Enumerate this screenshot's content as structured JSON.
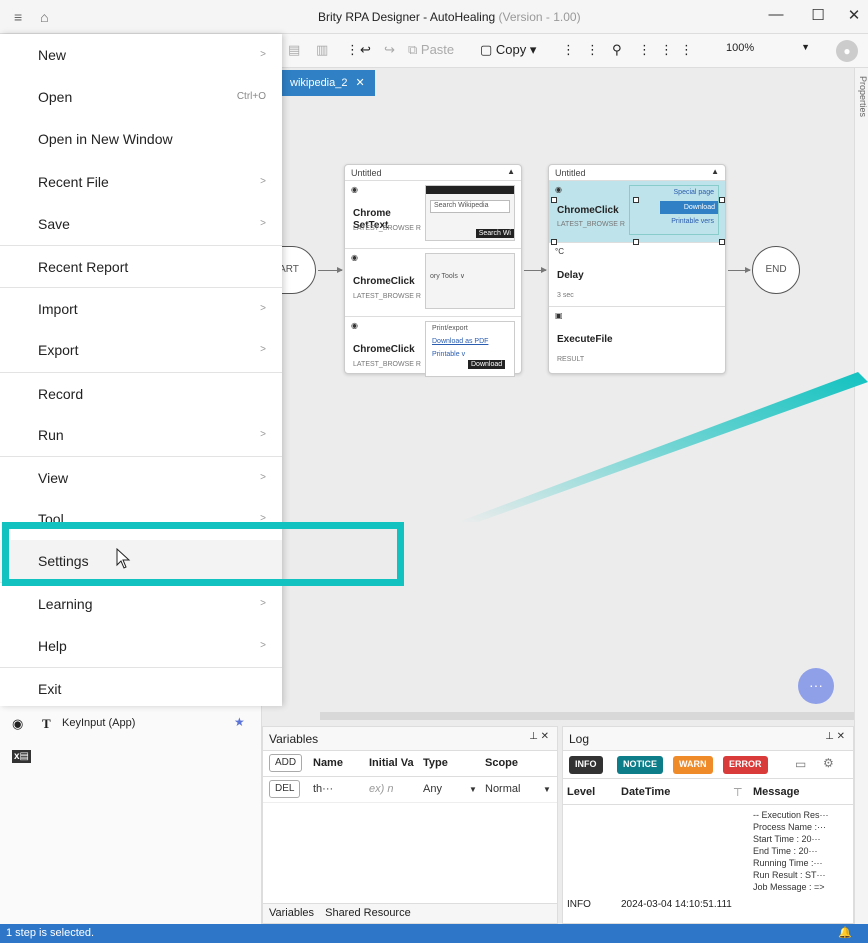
{
  "window": {
    "title": "Brity RPA Designer - AutoHealing",
    "version": "(Version - 1.00)",
    "menu_icon": "hamburger-icon",
    "home_icon": "home-icon",
    "minimize": "—",
    "maximize": "☐",
    "close": "✕"
  },
  "toolbar": {
    "paste_label": "Paste",
    "copy_label": "Copy",
    "zoom_value": "100%"
  },
  "tab": {
    "label": "wikipedia_2",
    "close": "✕"
  },
  "right_panel_label": "Properties",
  "menu": {
    "items": [
      {
        "label": "New",
        "shortcut": "",
        "chevron": ">",
        "sep": false
      },
      {
        "label": "Open",
        "shortcut": "Ctrl+O",
        "chevron": "",
        "sep": false
      },
      {
        "label": "Open in New Window",
        "shortcut": "",
        "chevron": "",
        "sep": false
      },
      {
        "label": "Recent File",
        "shortcut": "",
        "chevron": ">",
        "sep": false
      },
      {
        "label": "Save",
        "shortcut": "",
        "chevron": ">",
        "sep": false
      },
      {
        "label": "Recent Report",
        "shortcut": "",
        "chevron": "",
        "sep": true
      },
      {
        "label": "Import",
        "shortcut": "",
        "chevron": ">",
        "sep": true
      },
      {
        "label": "Export",
        "shortcut": "",
        "chevron": ">",
        "sep": false
      },
      {
        "label": "Record",
        "shortcut": "",
        "chevron": "",
        "sep": true
      },
      {
        "label": "Run",
        "shortcut": "",
        "chevron": ">",
        "sep": false
      },
      {
        "label": "View",
        "shortcut": "",
        "chevron": ">",
        "sep": true
      },
      {
        "label": "Tool",
        "shortcut": "",
        "chevron": ">",
        "sep": false
      },
      {
        "label": "Settings",
        "shortcut": "",
        "chevron": "",
        "sep": false
      },
      {
        "label": "Learning",
        "shortcut": "",
        "chevron": ">",
        "sep": true
      },
      {
        "label": "Help",
        "shortcut": "",
        "chevron": ">",
        "sep": false
      },
      {
        "label": "Exit",
        "shortcut": "",
        "chevron": "",
        "sep": true
      }
    ]
  },
  "flow": {
    "start_label": "START",
    "end_label": "END",
    "group1": {
      "title": "Untitled",
      "steps": [
        {
          "name": "Chrome SetText",
          "sub": "LATEST_BROWSE R",
          "thumb": "Search Wikipedia",
          "thumb2": "Search Wi"
        },
        {
          "name": "ChromeClick",
          "sub": "LATEST_BROWSE R",
          "thumb": "ory  Tools ∨",
          "thumb2": ""
        },
        {
          "name": "ChromeClick",
          "sub": "LATEST_BROWSE R",
          "thumb": "Print/export",
          "thumb2": "Download as PDF",
          "thumb3": "Printable v",
          "thumb4": "Download"
        }
      ]
    },
    "group2": {
      "title": "Untitled",
      "steps": [
        {
          "name": "ChromeClick",
          "sub": "LATEST_BROWSE R",
          "thumb": "Special page",
          "thumb2": "Download",
          "thumb3": "Printable vers"
        },
        {
          "name": "Delay",
          "sub": "3 sec",
          "icon": "°C"
        },
        {
          "name": "ExecuteFile",
          "sub": "RESULT",
          "icon": "▣"
        }
      ]
    }
  },
  "left_panel": {
    "item_label": "KeyInput (App)",
    "item_prefix": "T"
  },
  "variables": {
    "title": "Variables",
    "add_label": "ADD",
    "del_label": "DEL",
    "columns": [
      "Name",
      "Initial Va",
      "Type",
      "Scope"
    ],
    "row": {
      "name": "th···",
      "initial": "ex) n",
      "type": "Any",
      "scope": "Normal"
    },
    "tabs": [
      "Variables",
      "Shared Resource"
    ]
  },
  "log": {
    "title": "Log",
    "filters": [
      {
        "label": "INFO",
        "color": "#333333"
      },
      {
        "label": "NOTICE",
        "color": "#0d7d8a"
      },
      {
        "label": "WARN",
        "color": "#f08b2a"
      },
      {
        "label": "ERROR",
        "color": "#d93a3a"
      }
    ],
    "columns": [
      "Level",
      "DateTime",
      "Message"
    ],
    "row": {
      "level": "INFO",
      "datetime": "2024-03-04 14:10:51.111",
      "message_lines": [
        "-- Execution Res···",
        "Process Name :···",
        "Start Time  : 20···",
        "End Time   : 20···",
        "Running Time :···",
        "Run Result  : ST···",
        "Job Message : =>"
      ]
    }
  },
  "status": {
    "text": "1 step is selected."
  },
  "colors": {
    "accent": "#11c2c0",
    "status_bar": "#2e76c7",
    "tab": "#2f80c4"
  }
}
